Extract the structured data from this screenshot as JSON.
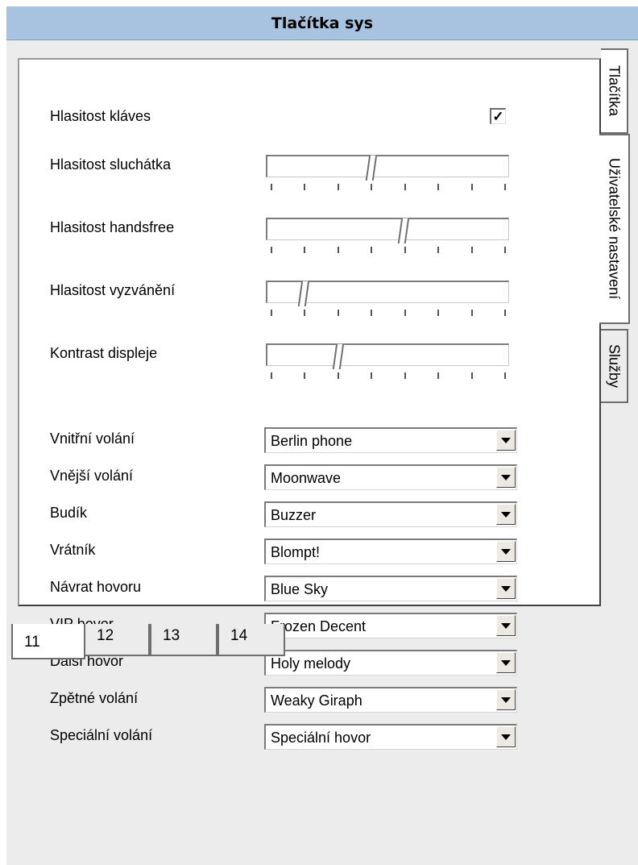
{
  "window": {
    "title": "Tlačítka sys"
  },
  "side_tabs": [
    {
      "label": "Tlačítka",
      "active": true
    },
    {
      "label": "Uživatelské nastavení",
      "active": false
    },
    {
      "label": "Služby",
      "active": false
    }
  ],
  "bottom_tabs": [
    {
      "label": "11",
      "active": true
    },
    {
      "label": "12",
      "active": false
    },
    {
      "label": "13",
      "active": false
    },
    {
      "label": "14",
      "active": false
    }
  ],
  "settings": {
    "key_volume": {
      "label": "Hlasitost kláves",
      "checked": true,
      "check_glyph": "✓"
    },
    "sliders": [
      {
        "label": "Hlasitost sluchátka",
        "level_fraction": 0.43,
        "ticks": 8
      },
      {
        "label": "Hlasitost handsfree",
        "level_fraction": 0.57,
        "ticks": 8
      },
      {
        "label": "Hlasitost vyzvánění",
        "level_fraction": 0.14,
        "ticks": 8
      },
      {
        "label": "Kontrast displeje",
        "level_fraction": 0.29,
        "ticks": 8
      }
    ],
    "ringtones": [
      {
        "label": "Vnitřní volání",
        "value": "Berlin phone"
      },
      {
        "label": "Vnější volání",
        "value": "Moonwave"
      },
      {
        "label": "Budík",
        "value": "Buzzer"
      },
      {
        "label": "Vrátník",
        "value": "Blompt!"
      },
      {
        "label": "Návrat hovoru",
        "value": "Blue Sky"
      },
      {
        "label": "VIP hovor",
        "value": "Frozen Decent"
      },
      {
        "label": "Další hovor",
        "value": "Holy melody"
      },
      {
        "label": "Zpětné volání",
        "value": "Weaky Giraph"
      },
      {
        "label": "Speciální volání",
        "value": "Speciální hovor"
      }
    ]
  },
  "icons": {
    "dropdown_arrow": "chevron-down-icon",
    "checkbox": "check-icon"
  }
}
